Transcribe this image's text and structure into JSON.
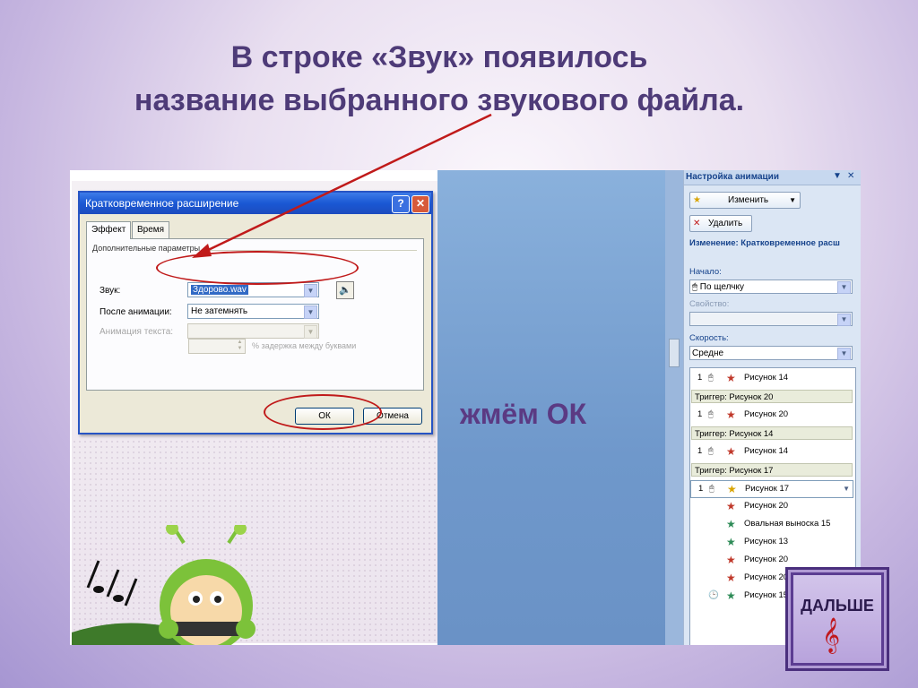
{
  "title": {
    "line1": "В строке «Звук» появилось",
    "line2": "название выбранного звукового файла."
  },
  "note": "жмём ОК",
  "next_button": {
    "label": "ДАЛЬШЕ",
    "icon": "treble-clef-icon"
  },
  "dialog": {
    "title": "Кратковременное расширение",
    "help": "?",
    "close": "✕",
    "tabs": [
      "Эффект",
      "Время"
    ],
    "group": "Дополнительные параметры",
    "sound_label": "Звук:",
    "sound_value": "Здорово.wav",
    "after_label": "После анимации:",
    "after_value": "Не затемнять",
    "text_anim_label": "Анимация текста:",
    "delay_text": "% задержка между буквами",
    "ok": "ОК",
    "cancel": "Отмена"
  },
  "pane": {
    "title": "Настройка анимации",
    "change_btn": "Изменить",
    "delete_btn": "Удалить",
    "change_info": "Изменение: Кратковременное расш",
    "start_label": "Начало:",
    "start_value": "По щелчку",
    "property_label": "Свойство:",
    "speed_label": "Скорость:",
    "speed_value": "Средне",
    "items": [
      {
        "n": "1",
        "t": "Рисунок 14"
      },
      {
        "trigger": "Триггер: Рисунок 20"
      },
      {
        "n": "1",
        "t": "Рисунок 20"
      },
      {
        "trigger": "Триггер: Рисунок 14"
      },
      {
        "n": "1",
        "t": "Рисунок 14"
      },
      {
        "trigger": "Триггер: Рисунок 17"
      },
      {
        "n": "1",
        "t": "Рисунок 17"
      },
      {
        "n": "",
        "t": "Рисунок 20"
      },
      {
        "n": "",
        "t": "Овальная выноска 15"
      },
      {
        "n": "",
        "t": "Рисунок 13"
      },
      {
        "n": "",
        "t": "Рисунок 20"
      },
      {
        "n": "",
        "t": "Рисунок 20"
      },
      {
        "n": "",
        "t": "Рисунок 15"
      }
    ]
  },
  "colors": {
    "title": "#4e3b78",
    "ellipse": "#c01a1a",
    "arrow": "#c01a1a"
  }
}
